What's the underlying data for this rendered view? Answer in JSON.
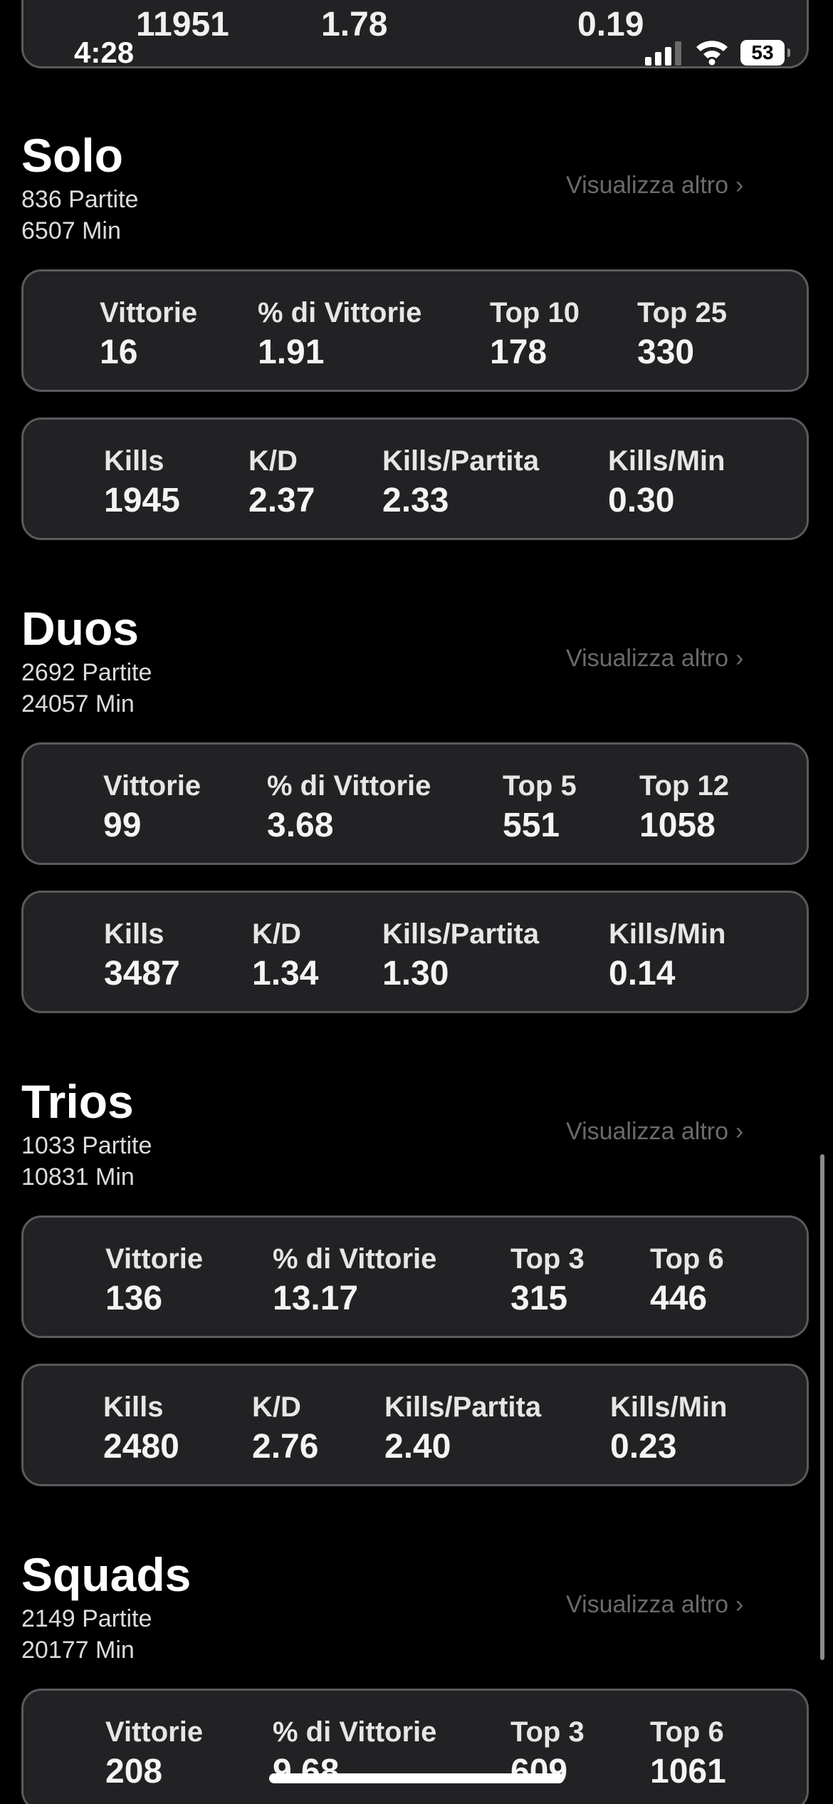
{
  "status_bar": {
    "time": "4:28",
    "battery": "53"
  },
  "top_card": {
    "values": [
      "11951",
      "1.78",
      "0.19"
    ]
  },
  "sections": [
    {
      "title": "Solo",
      "matches": "836 Partite",
      "minutes": "6507 Min",
      "more": "Visualizza altro",
      "row1": [
        {
          "label": "Vittorie",
          "value": "16"
        },
        {
          "label": "% di Vittorie",
          "value": "1.91"
        },
        {
          "label": "Top 10",
          "value": "178"
        },
        {
          "label": "Top 25",
          "value": "330"
        }
      ],
      "row2": [
        {
          "label": "Kills",
          "value": "1945"
        },
        {
          "label": "K/D",
          "value": "2.37"
        },
        {
          "label": "Kills/Partita",
          "value": "2.33"
        },
        {
          "label": "Kills/Min",
          "value": "0.30"
        }
      ]
    },
    {
      "title": "Duos",
      "matches": "2692 Partite",
      "minutes": "24057 Min",
      "more": "Visualizza altro",
      "row1": [
        {
          "label": "Vittorie",
          "value": "99"
        },
        {
          "label": "% di Vittorie",
          "value": "3.68"
        },
        {
          "label": "Top 5",
          "value": "551"
        },
        {
          "label": "Top 12",
          "value": "1058"
        }
      ],
      "row2": [
        {
          "label": "Kills",
          "value": "3487"
        },
        {
          "label": "K/D",
          "value": "1.34"
        },
        {
          "label": "Kills/Partita",
          "value": "1.30"
        },
        {
          "label": "Kills/Min",
          "value": "0.14"
        }
      ]
    },
    {
      "title": "Trios",
      "matches": "1033 Partite",
      "minutes": "10831 Min",
      "more": "Visualizza altro",
      "row1": [
        {
          "label": "Vittorie",
          "value": "136"
        },
        {
          "label": "% di Vittorie",
          "value": "13.17"
        },
        {
          "label": "Top 3",
          "value": "315"
        },
        {
          "label": "Top 6",
          "value": "446"
        }
      ],
      "row2": [
        {
          "label": "Kills",
          "value": "2480"
        },
        {
          "label": "K/D",
          "value": "2.76"
        },
        {
          "label": "Kills/Partita",
          "value": "2.40"
        },
        {
          "label": "Kills/Min",
          "value": "0.23"
        }
      ]
    },
    {
      "title": "Squads",
      "matches": "2149 Partite",
      "minutes": "20177 Min",
      "more": "Visualizza altro",
      "row1": [
        {
          "label": "Vittorie",
          "value": "208"
        },
        {
          "label": "% di Vittorie",
          "value": "9.68"
        },
        {
          "label": "Top 3",
          "value": "609"
        },
        {
          "label": "Top 6",
          "value": "1061"
        }
      ]
    }
  ]
}
